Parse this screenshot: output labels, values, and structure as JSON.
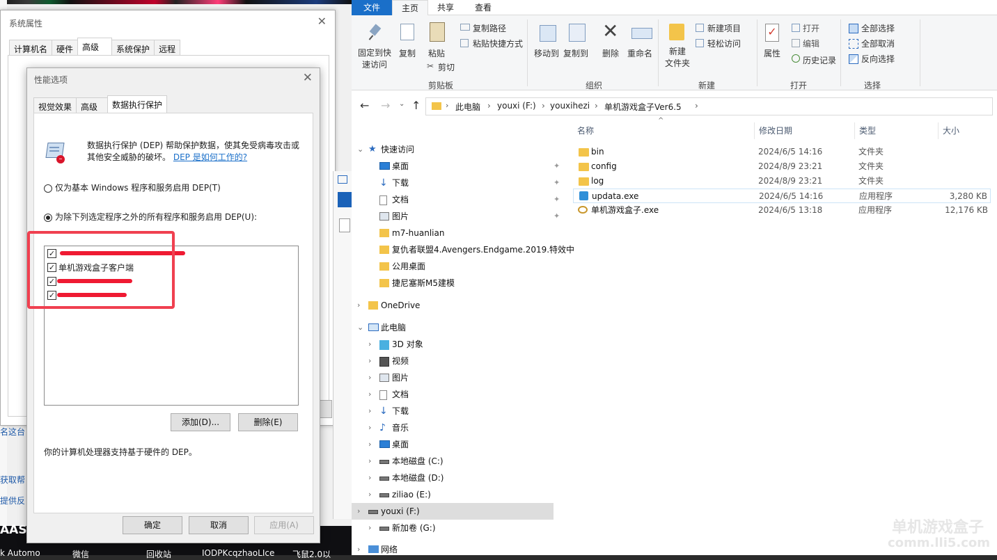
{
  "taskbar": {
    "items": [
      "k Automo",
      "微信",
      "回收站",
      "IODPKcqzhaoLIce",
      "飞鼠2.0以"
    ]
  },
  "left_edge": {
    "texts": [
      "名这台",
      "获取帮",
      "提供反",
      "AAS"
    ]
  },
  "system_properties": {
    "title": "系统属性",
    "close": "✕",
    "tabs": [
      {
        "label": "计算机名"
      },
      {
        "label": "硬件"
      },
      {
        "label": "高级"
      },
      {
        "label": "系统保护"
      },
      {
        "label": "远程"
      }
    ],
    "active_tab": "高级"
  },
  "performance_options": {
    "title": "性能选项",
    "close": "✕",
    "tabs": [
      {
        "label": "视觉效果"
      },
      {
        "label": "高级"
      },
      {
        "label": "数据执行保护"
      }
    ],
    "active_tab": "数据执行保护",
    "description": "数据执行保护 (DEP) 帮助保护数据，使其免受病毒攻击或其他安全威胁的破坏。",
    "description_line1": "数据执行保护 (DEP) 帮助保护数据，使其免受病毒攻击或",
    "description_line2": "其他安全威胁的破坏。",
    "help_link": "DEP 是如何工作的?",
    "option1": "仅为基本 Windows 程序和服务启用 DEP(T)",
    "option2": "为除下列选定程序之外的所有程序和服务启用 DEP(U):",
    "selected_option": 2,
    "programs": [
      {
        "label": "",
        "checked": true
      },
      {
        "label": "单机游戏盒子客户端",
        "checked": true
      },
      {
        "label": "",
        "checked": true
      },
      {
        "label": "",
        "checked": true
      }
    ],
    "add_button": "添加(D)...",
    "remove_button": "删除(E)",
    "hardware_note": "你的计算机处理器支持基于硬件的 DEP。",
    "ok_button": "确定",
    "cancel_button": "取消",
    "apply_button": "应用(A)"
  },
  "explorer": {
    "ribbon_tabs": [
      "文件",
      "主页",
      "共享",
      "查看"
    ],
    "active_tab": "主页",
    "clipboard": {
      "pin_line1": "固定到快",
      "pin_line2": "速访问",
      "copy": "复制",
      "paste": "粘贴",
      "copy_path": "复制路径",
      "paste_shortcut": "粘贴快捷方式",
      "cut": "剪切",
      "group": "剪贴板"
    },
    "organize": {
      "move_to": "移动到",
      "copy_to": "复制到",
      "delete": "删除",
      "rename": "重命名",
      "group": "组织"
    },
    "new": {
      "new_folder_line1": "新建",
      "new_folder_line2": "文件夹",
      "new_item": "新建项目",
      "easy_access": "轻松访问",
      "group": "新建"
    },
    "open": {
      "properties": "属性",
      "open": "打开",
      "edit": "编辑",
      "history": "历史记录",
      "group": "打开"
    },
    "select": {
      "select_all": "全部选择",
      "select_none": "全部取消",
      "invert": "反向选择",
      "group": "选择"
    },
    "breadcrumb": [
      "此电脑",
      "youxi (F:)",
      "youxihezi",
      "单机游戏盒子Ver6.5"
    ],
    "columns": {
      "name": "名称",
      "date": "修改日期",
      "type": "类型",
      "size": "大小"
    },
    "files": [
      {
        "name": "bin",
        "date": "2024/6/5 14:16",
        "type": "文件夹",
        "size": "",
        "kind": "folder"
      },
      {
        "name": "config",
        "date": "2024/8/9 23:21",
        "type": "文件夹",
        "size": "",
        "kind": "folder"
      },
      {
        "name": "log",
        "date": "2024/8/9 23:21",
        "type": "文件夹",
        "size": "",
        "kind": "folder"
      },
      {
        "name": "updata.exe",
        "date": "2024/6/5 14:16",
        "type": "应用程序",
        "size": "3,280 KB",
        "kind": "exe"
      },
      {
        "name": "单机游戏盒子.exe",
        "date": "2024/6/5 13:18",
        "type": "应用程序",
        "size": "12,176 KB",
        "kind": "exe2"
      }
    ],
    "tree": [
      {
        "label": "快速访问",
        "level": 0,
        "icon": "star-icon",
        "expand": "v"
      },
      {
        "label": "桌面",
        "level": 1,
        "icon": "desktop-icon",
        "pin": true
      },
      {
        "label": "下载",
        "level": 1,
        "icon": "download-icon",
        "pin": true
      },
      {
        "label": "文档",
        "level": 1,
        "icon": "document-icon",
        "pin": true
      },
      {
        "label": "图片",
        "level": 1,
        "icon": "picture-icon",
        "pin": true
      },
      {
        "label": "m7-huanlian",
        "level": 1,
        "icon": "folder-icon"
      },
      {
        "label": "复仇者联盟4.Avengers.Endgame.2019.特效中",
        "level": 1,
        "icon": "folder-icon"
      },
      {
        "label": "公用桌面",
        "level": 1,
        "icon": "folder-icon"
      },
      {
        "label": "捷尼塞斯M5建模",
        "level": 1,
        "icon": "folder-icon"
      },
      {
        "label": "OneDrive",
        "level": 0,
        "icon": "folder-icon",
        "expand": ">"
      },
      {
        "label": "此电脑",
        "level": 0,
        "icon": "pc-icon",
        "expand": "v"
      },
      {
        "label": "3D 对象",
        "level": 1,
        "icon": "cube-icon",
        "expand": ">"
      },
      {
        "label": "视频",
        "level": 1,
        "icon": "video-icon",
        "expand": ">"
      },
      {
        "label": "图片",
        "level": 1,
        "icon": "picture-icon",
        "expand": ">"
      },
      {
        "label": "文档",
        "level": 1,
        "icon": "document-icon",
        "expand": ">"
      },
      {
        "label": "下载",
        "level": 1,
        "icon": "download-icon",
        "expand": ">"
      },
      {
        "label": "音乐",
        "level": 1,
        "icon": "music-icon",
        "expand": ">"
      },
      {
        "label": "桌面",
        "level": 1,
        "icon": "desktop-icon",
        "expand": ">"
      },
      {
        "label": "本地磁盘 (C:)",
        "level": 1,
        "icon": "drive-icon",
        "expand": ">"
      },
      {
        "label": "本地磁盘 (D:)",
        "level": 1,
        "icon": "drive-icon",
        "expand": ">"
      },
      {
        "label": "ziliao (E:)",
        "level": 1,
        "icon": "drive-icon",
        "expand": ">"
      },
      {
        "label": "youxi (F:)",
        "level": 1,
        "icon": "drive-icon",
        "expand": ">",
        "selected": true
      },
      {
        "label": "新加卷 (G:)",
        "level": 1,
        "icon": "drive-icon",
        "expand": ">"
      },
      {
        "label": "网络",
        "level": 0,
        "icon": "network-icon",
        "expand": ">"
      }
    ],
    "watermark_line1": "单机游戏盒子",
    "watermark_line2": "comm.lli5.com"
  },
  "colors": {
    "accent": "#1a6fc9",
    "highlight_box": "#f04050",
    "redact": "#ef1a32"
  }
}
